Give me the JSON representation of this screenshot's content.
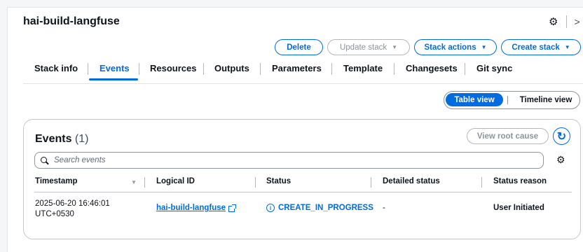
{
  "stack": {
    "name": "hai-build-langfuse"
  },
  "toolbar": {
    "delete_label": "Delete",
    "update_stack_label": "Update stack",
    "stack_actions_label": "Stack actions",
    "create_stack_label": "Create stack"
  },
  "tabs": [
    {
      "label": "Stack info"
    },
    {
      "label": "Events"
    },
    {
      "label": "Resources"
    },
    {
      "label": "Outputs"
    },
    {
      "label": "Parameters"
    },
    {
      "label": "Template"
    },
    {
      "label": "Changesets"
    },
    {
      "label": "Git sync"
    }
  ],
  "active_tab": "Events",
  "view_toggle": {
    "table_view": "Table view",
    "timeline_view": "Timeline view",
    "selected": "Table view"
  },
  "events": {
    "title": "Events",
    "count": "(1)",
    "view_root_cause_label": "View root cause",
    "search_placeholder": "Search events",
    "columns": [
      "Timestamp",
      "Logical ID",
      "Status",
      "Detailed status",
      "Status reason"
    ],
    "rows": [
      {
        "timestamp_line1": "2025-06-20 16:46:01",
        "timestamp_line2": "UTC+0530",
        "logical_id": "hai-build-langfuse",
        "status": "CREATE_IN_PROGRESS",
        "detailed_status": "-",
        "status_reason": "User Initiated"
      }
    ]
  },
  "icons": {
    "settings": "gear-icon",
    "panel_toggle": "chevron-right-icon",
    "refresh": "refresh-icon",
    "search": "search-icon",
    "external_link": "external-link-icon",
    "status_info": "info-icon"
  },
  "colors": {
    "accent": "#006ce0",
    "disabled": "#8d949c",
    "text": "#0f141a"
  }
}
